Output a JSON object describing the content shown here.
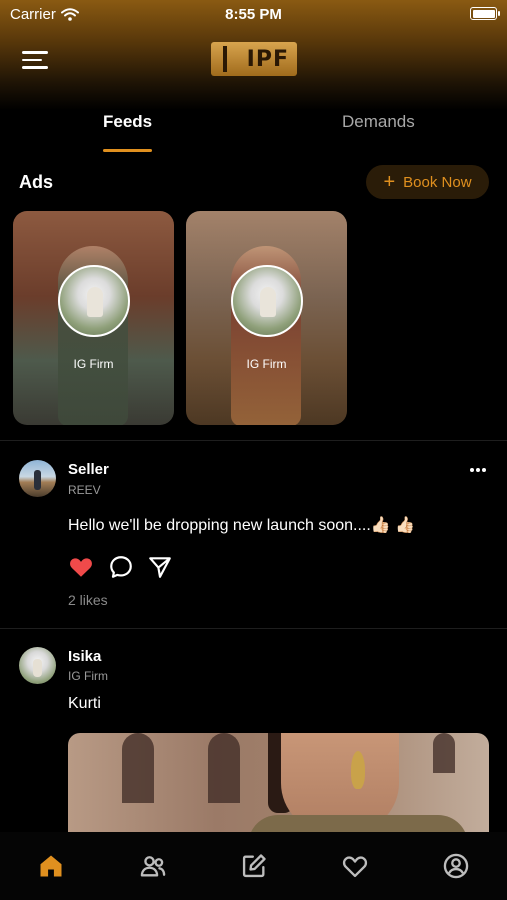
{
  "status_bar": {
    "carrier": "Carrier",
    "time": "8:55 PM"
  },
  "header": {
    "logo_text": "IPF"
  },
  "tabs": [
    {
      "label": "Feeds",
      "active": true
    },
    {
      "label": "Demands",
      "active": false
    }
  ],
  "ads": {
    "title": "Ads",
    "book_label": "Book Now",
    "items": [
      {
        "label": "IG Firm"
      },
      {
        "label": "IG Firm"
      }
    ]
  },
  "posts": [
    {
      "author": "Seller",
      "subtitle": "REEV",
      "text": "Hello we'll be dropping new launch soon....👍🏻 👍🏻",
      "likes": "2 likes",
      "liked": true
    },
    {
      "author": "Isika",
      "subtitle": "IG Firm",
      "text": "Kurti"
    }
  ],
  "icons": {
    "menu": "hamburger-menu-icon",
    "like": "heart-icon",
    "comment": "comment-bubble-icon",
    "share": "send-icon",
    "more": "more-horizontal-icon",
    "nav": [
      "home-icon",
      "users-icon",
      "edit-icon",
      "heart-icon",
      "profile-icon"
    ]
  },
  "colors": {
    "accent": "#e0901f",
    "like": "#f04a4a",
    "background": "#000000"
  }
}
